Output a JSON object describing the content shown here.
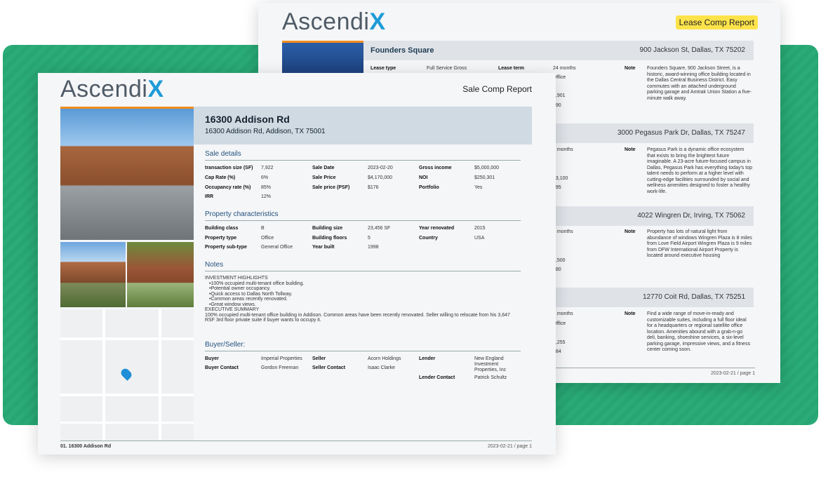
{
  "brand": {
    "logo_main": "Ascendi",
    "logo_x": "X",
    "accent": "#1e9bd7",
    "green": "#27a572"
  },
  "lease_report": {
    "title": "Lease Comp Report",
    "footer": "2023-02-21 / page 1",
    "rows": [
      {
        "name": "Founders Square",
        "address": "900 Jackson St, Dallas, TX 75202",
        "note": "Founders Square, 900 Jackson Street, is a historic, award-winning office building located in the Dallas Central Business District. Easy commutes with an attached underground parking garage and Amtrak Union Station a five-minute walk away.",
        "partial": [
          "Office",
          "4,901",
          "990"
        ]
      },
      {
        "name": "",
        "address": "3000 Pegasus Park Dr, Dallas, TX 75247",
        "note": "Pegasus Park is a dynamic office ecosystem that exists to bring the brightest future imaginable. A 23-acre future-focused campus in Dallas, Pegasus Park has everything today's top talent needs to perform at a higher level with cutting-edge facilities surrounded by social and wellness amenities designed to foster a healthy work-life.",
        "partial": [
          "8 months",
          "e",
          "93,100",
          "995"
        ]
      },
      {
        "name": "",
        "address": "4022 Wingren Dr, Irving, TX 75062",
        "note": "Property has lots of natural light from abundance of windows Wingren Plaza is 8 miles from Love Field Airport Wingren Plaza is 9 miles from DFW International Airport Property is located around executive housing",
        "partial": [
          "6 months",
          "e",
          "4,500",
          "980"
        ]
      },
      {
        "name": "",
        "address": "12770 Coit Rd, Dallas, TX 75251",
        "note": "Find a wide range of move-in-ready and customizable suites, including a full floor ideal for a headquarters or regional satellite office location. Amenities abound with a grab-n-go deli, banking, shoeshine services, a six-level parking garage, impressive views, and a fitness center coming soon.",
        "partial": [
          "4 months",
          "Office",
          "0,255",
          "984"
        ]
      }
    ],
    "first_labels": {
      "lease_type_label": "Lease type",
      "lease_type_value": "Full Service Gross",
      "lease_term_label": "Lease term",
      "lease_term_value": "24 months",
      "note_label": "Note"
    }
  },
  "sale_report": {
    "title": "Sale Comp Report",
    "property_name": "16300 Addison Rd",
    "property_address": "16300 Addison Rd, Addison, TX 75001",
    "sections": {
      "sale_details": "Sale details",
      "property_characteristics": "Property characteristics",
      "notes": "Notes",
      "buyer_seller": "Buyer/Seller:"
    },
    "sale_details": [
      {
        "label": "transaction size (SF)",
        "value": "7,922"
      },
      {
        "label": "Cap Rate (%)",
        "value": "6%"
      },
      {
        "label": "Occupancy rate (%)",
        "value": "85%"
      },
      {
        "label": "IRR",
        "value": "12%"
      },
      {
        "label": "Sale Date",
        "value": "2023-02-20"
      },
      {
        "label": "Sale Price",
        "value": "$4,170,000"
      },
      {
        "label": "Sale price (PSF)",
        "value": "$176"
      },
      {
        "label": "Gross income",
        "value": "$5,000,000"
      },
      {
        "label": "NOI",
        "value": "$250,301"
      },
      {
        "label": "Portfolio",
        "value": "Yes"
      }
    ],
    "property_characteristics": [
      {
        "label": "Building class",
        "value": "B"
      },
      {
        "label": "Property type",
        "value": "Office"
      },
      {
        "label": "Property sub-type",
        "value": "General Office"
      },
      {
        "label": "Building size",
        "value": "23,456 SF"
      },
      {
        "label": "Building floors",
        "value": "5"
      },
      {
        "label": "Year built",
        "value": "1998"
      },
      {
        "label": "Year renovated",
        "value": "2015"
      },
      {
        "label": "Country",
        "value": "USA"
      }
    ],
    "notes": {
      "highlights_title": "INVESTMENT HIGHLIGHTS",
      "highlights": [
        "100% occupied multi-tenant office building.",
        "Potential owner occupancy.",
        "Quick access to Dallas North Tollway.",
        "Common areas recently renovated.",
        "Great window views."
      ],
      "summary_title": "EXECUTIVE SUMMARY",
      "summary": "100% occupied multi-tenant office building in Addison. Common areas have been recently renovated. Seller willing to relocate from his 3,647 RSF 3rd floor private suite if buyer wants to occupy it."
    },
    "buyer_seller": [
      {
        "label": "Buyer",
        "value": "Imperial Properties"
      },
      {
        "label": "Buyer Contact",
        "value": "Gordon Freeman"
      },
      {
        "label": "Seller",
        "value": "Acorn Holdings"
      },
      {
        "label": "Seller Contact",
        "value": "Isaac Clarke"
      },
      {
        "label": "Lender",
        "value": "New England Investment Properties, Inc"
      },
      {
        "label": "Lender Contact",
        "value": "Patrick Schultz"
      }
    ],
    "footer_left": "01. 16300 Addison Rd",
    "footer_right": "2023-02-21 / page 1"
  }
}
